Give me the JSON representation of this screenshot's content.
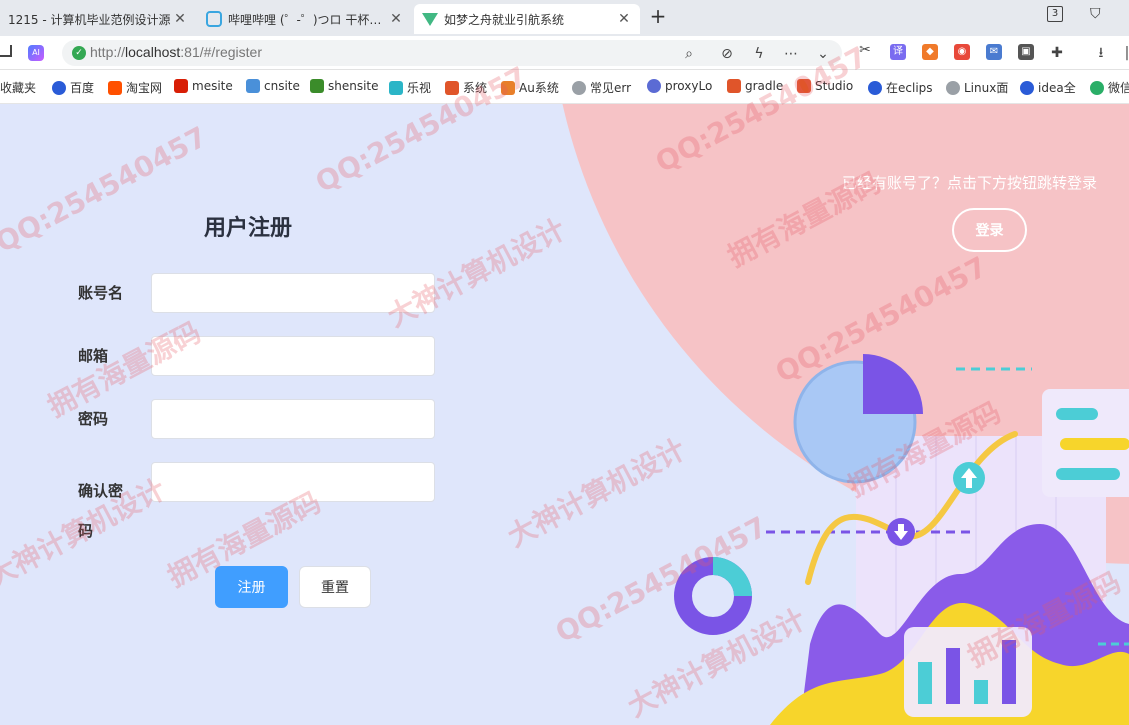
{
  "browser": {
    "tabs": [
      {
        "title": "1215 - 计算机毕业范例设计源",
        "active": false
      },
      {
        "title": "哔哩哔哩 (゜-゜)つロ 干杯~-bilibili",
        "active": false
      },
      {
        "title": "如梦之舟就业引航系统",
        "active": true
      }
    ],
    "new_tab": "+",
    "tab_count": "3",
    "url_prefix": "http://",
    "url_host": "localhost",
    "url_rest": ":81/#/register",
    "ai_badge": "AI",
    "bookmarks": [
      {
        "label": "收藏夹",
        "color": "#f2b233"
      },
      {
        "label": "百度",
        "color": "#2a5bd7"
      },
      {
        "label": "淘宝网",
        "color": "#ff5000"
      },
      {
        "label": "mesite",
        "color": "#d81e06"
      },
      {
        "label": "cnsite",
        "color": "#4a90d9"
      },
      {
        "label": "shensite",
        "color": "#3b8c2a"
      },
      {
        "label": "乐视",
        "color": "#2bb5c7"
      },
      {
        "label": "系统",
        "color": "#e0552a"
      },
      {
        "label": "Au系统",
        "color": "#e87f2a"
      },
      {
        "label": "常见err",
        "color": "#9aa0a6"
      },
      {
        "label": "proxyLo",
        "color": "#5b6bd4"
      },
      {
        "label": "gradle",
        "color": "#e0552a"
      },
      {
        "label": "Studio",
        "color": "#e0552a"
      },
      {
        "label": "在eclips",
        "color": "#2a5bd7"
      },
      {
        "label": "Linux面",
        "color": "#9aa0a6"
      },
      {
        "label": "idea全",
        "color": "#2a5bd7"
      },
      {
        "label": "微信",
        "color": "#2aae67"
      }
    ]
  },
  "register": {
    "title": "用户注册",
    "fields": [
      {
        "label": "账号名",
        "value": ""
      },
      {
        "label": "邮箱",
        "value": ""
      },
      {
        "label": "密码",
        "value": ""
      },
      {
        "label": "确认密码",
        "value": ""
      }
    ],
    "submit_label": "注册",
    "reset_label": "重置"
  },
  "side": {
    "prompt": "已经有账号了？点击下方按钮跳转登录",
    "login_label": "登录"
  },
  "watermark": {
    "lines": [
      "大神计算机设计",
      "QQ:254540457",
      "拥有海量源码"
    ]
  },
  "colors": {
    "primary": "#409eff",
    "page_bg": "#dfe6fb",
    "pink": "#f6c3c6"
  }
}
